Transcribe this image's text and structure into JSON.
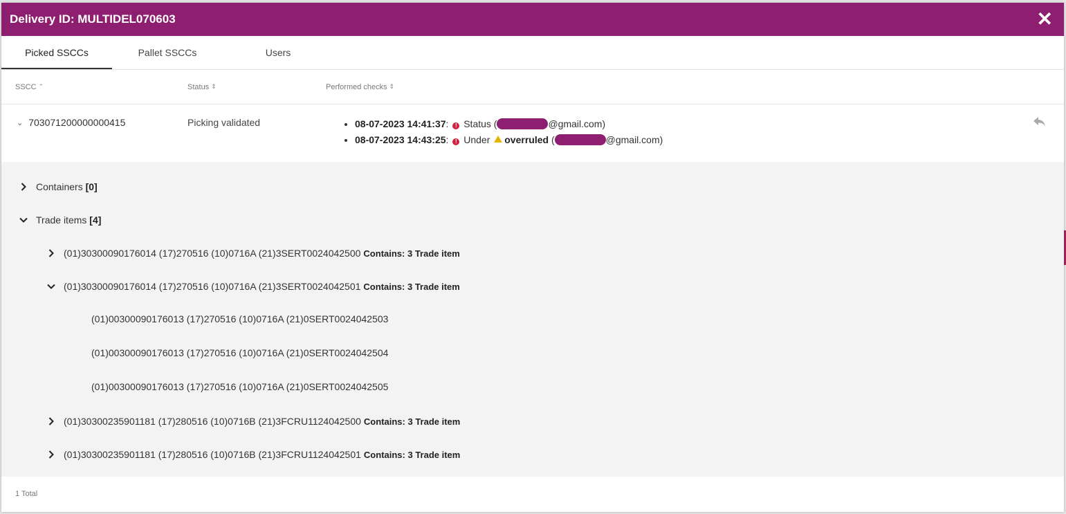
{
  "modal": {
    "title": "Delivery ID: MULTIDEL070603",
    "close_glyph": "✕"
  },
  "tabs": [
    {
      "label": "Picked SSCCs",
      "active": true
    },
    {
      "label": "Pallet SSCCs",
      "active": false
    },
    {
      "label": "Users",
      "active": false
    }
  ],
  "table": {
    "columns": [
      "SSCC",
      "Status",
      "Performed checks"
    ],
    "row": {
      "sscc": "703071200000000415",
      "status": "Picking validated",
      "checks": [
        {
          "timestamp": "08-07-2023 14:41:37",
          "sep": ":",
          "text": "Status (",
          "email_suffix": "@gmail.com)"
        },
        {
          "timestamp": "08-07-2023 14:43:25",
          "sep": ":",
          "text": "Under",
          "bold": "overruled",
          "paren": " (",
          "email_suffix": "@gmail.com)"
        }
      ]
    }
  },
  "tree": {
    "containers": {
      "label": "Containers",
      "count": "[0]"
    },
    "trade_items": {
      "label": "Trade items",
      "count": "[4]"
    },
    "items": [
      {
        "code": "(01)30300090176014 (17)270516 (10)0716A (21)3SERT0024042500",
        "contains": "Contains: 3 Trade item",
        "expanded": false
      },
      {
        "code": "(01)30300090176014 (17)270516 (10)0716A (21)3SERT0024042501",
        "contains": "Contains: 3 Trade item",
        "expanded": true,
        "children": [
          "(01)00300090176013 (17)270516 (10)0716A (21)0SERT0024042503",
          "(01)00300090176013 (17)270516 (10)0716A (21)0SERT0024042504",
          "(01)00300090176013 (17)270516 (10)0716A (21)0SERT0024042505"
        ]
      },
      {
        "code": "(01)30300235901181 (17)280516 (10)0716B (21)3FCRU1124042500",
        "contains": "Contains: 3 Trade item",
        "expanded": false
      },
      {
        "code": "(01)30300235901181 (17)280516 (10)0716B (21)3FCRU1124042501",
        "contains": "Contains: 3 Trade item",
        "expanded": false
      }
    ]
  },
  "footer": {
    "total": "1 Total"
  },
  "colors": {
    "header": "#8e1e6f",
    "error": "#d0223e",
    "warning": "#e6b400",
    "panel_bg": "#f3f3f3"
  },
  "icons": [
    "close-icon",
    "sort-icon",
    "chevron-down-icon",
    "chevron-right-icon",
    "error-icon",
    "warning-icon",
    "reply-icon"
  ]
}
